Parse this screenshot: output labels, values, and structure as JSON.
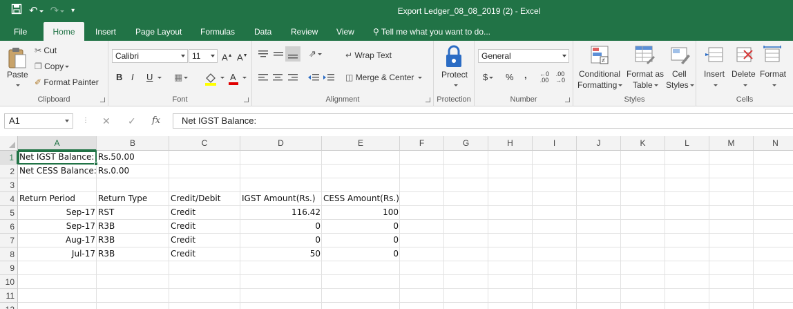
{
  "window": {
    "title": "Export Ledger_08_08_2019 (2)  -  Excel"
  },
  "tabs": [
    "File",
    "Home",
    "Insert",
    "Page Layout",
    "Formulas",
    "Data",
    "Review",
    "View"
  ],
  "tell_me": "Tell me what you want to do...",
  "ribbon": {
    "clipboard": {
      "paste": "Paste",
      "cut": "Cut",
      "copy": "Copy",
      "format_painter": "Format Painter",
      "label": "Clipboard"
    },
    "font": {
      "name": "Calibri",
      "size": "11",
      "bold": "B",
      "italic": "I",
      "underline": "U",
      "label": "Font"
    },
    "alignment": {
      "wrap_text": "Wrap Text",
      "merge_center": "Merge & Center",
      "label": "Alignment"
    },
    "protection": {
      "protect": "Protect",
      "label": "Protection"
    },
    "number": {
      "format": "General",
      "currency": "$",
      "percent": "%",
      "comma": ",",
      "label": "Number"
    },
    "styles": {
      "conditional_1": "Conditional",
      "conditional_2": "Formatting",
      "format_table_1": "Format as",
      "format_table_2": "Table",
      "cell_styles_1": "Cell",
      "cell_styles_2": "Styles",
      "label": "Styles"
    },
    "cells": {
      "insert": "Insert",
      "delete": "Delete",
      "format": "Format",
      "label": "Cells"
    }
  },
  "formula_bar": {
    "name_box": "A1",
    "fx": "fx",
    "content": "Net IGST Balance:"
  },
  "columns": [
    "A",
    "B",
    "C",
    "D",
    "E",
    "F",
    "G",
    "H",
    "I",
    "J",
    "K",
    "L",
    "M",
    "N"
  ],
  "rows": [
    "1",
    "2",
    "3",
    "4",
    "5",
    "6",
    "7",
    "8",
    "9",
    "10",
    "11",
    "12"
  ],
  "sheet": {
    "r1": {
      "a": "Net IGST Balance:",
      "b": "Rs.50.00"
    },
    "r2": {
      "a": "Net CESS Balance:",
      "b": "Rs.0.00"
    },
    "r4": {
      "a": "Return Period",
      "b": "Return Type",
      "c": "Credit/Debit",
      "d": "IGST Amount(Rs.)",
      "e": "CESS Amount(Rs.)"
    },
    "r5": {
      "a": "Sep-17",
      "b": "RST",
      "c": "Credit",
      "d": "116.42",
      "e": "100"
    },
    "r6": {
      "a": "Sep-17",
      "b": "R3B",
      "c": "Credit",
      "d": "0",
      "e": "0"
    },
    "r7": {
      "a": "Aug-17",
      "b": "R3B",
      "c": "Credit",
      "d": "0",
      "e": "0"
    },
    "r8": {
      "a": "Jul-17",
      "b": "R3B",
      "c": "Credit",
      "d": "50",
      "e": "0"
    }
  }
}
